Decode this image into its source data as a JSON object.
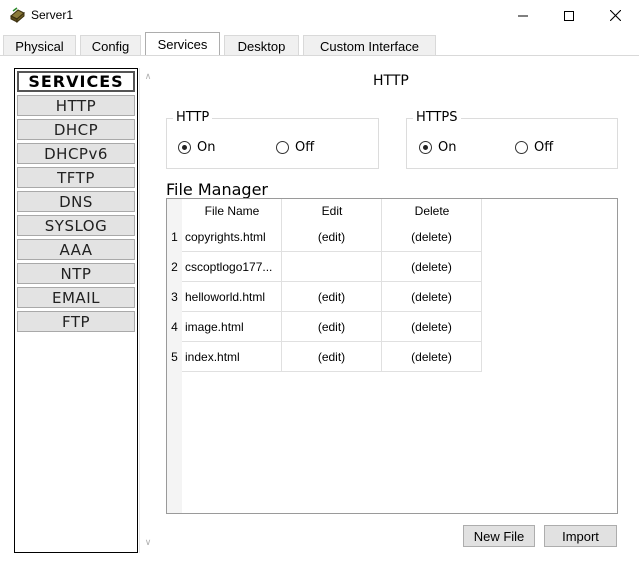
{
  "window": {
    "title": "Server1",
    "controls": [
      "minimize-icon",
      "maximize-icon",
      "close-icon"
    ]
  },
  "tabs": [
    {
      "label": "Physical",
      "active": false
    },
    {
      "label": "Config",
      "active": false
    },
    {
      "label": "Services",
      "active": true
    },
    {
      "label": "Desktop",
      "active": false
    },
    {
      "label": "Custom Interface",
      "active": false
    }
  ],
  "services": {
    "header": "SERVICES",
    "items": [
      "HTTP",
      "DHCP",
      "DHCPv6",
      "TFTP",
      "DNS",
      "SYSLOG",
      "AAA",
      "NTP",
      "EMAIL",
      "FTP"
    ]
  },
  "main": {
    "title": "HTTP",
    "http": {
      "legend": "HTTP",
      "on_label": "On",
      "off_label": "Off",
      "selected": "On"
    },
    "https": {
      "legend": "HTTPS",
      "on_label": "On",
      "off_label": "Off",
      "selected": "On"
    },
    "file_manager": {
      "title": "File Manager",
      "columns": [
        "File Name",
        "Edit",
        "Delete"
      ],
      "rows": [
        {
          "num": "1",
          "name": "copyrights.html",
          "edit": "(edit)",
          "delete": "(delete)"
        },
        {
          "num": "2",
          "name": "cscoptlogo177...",
          "edit": "",
          "delete": "(delete)"
        },
        {
          "num": "3",
          "name": "helloworld.html",
          "edit": "(edit)",
          "delete": "(delete)"
        },
        {
          "num": "4",
          "name": "image.html",
          "edit": "(edit)",
          "delete": "(delete)"
        },
        {
          "num": "5",
          "name": "index.html",
          "edit": "(edit)",
          "delete": "(delete)"
        }
      ]
    },
    "buttons": {
      "new_file": "New File",
      "import": "Import"
    }
  }
}
